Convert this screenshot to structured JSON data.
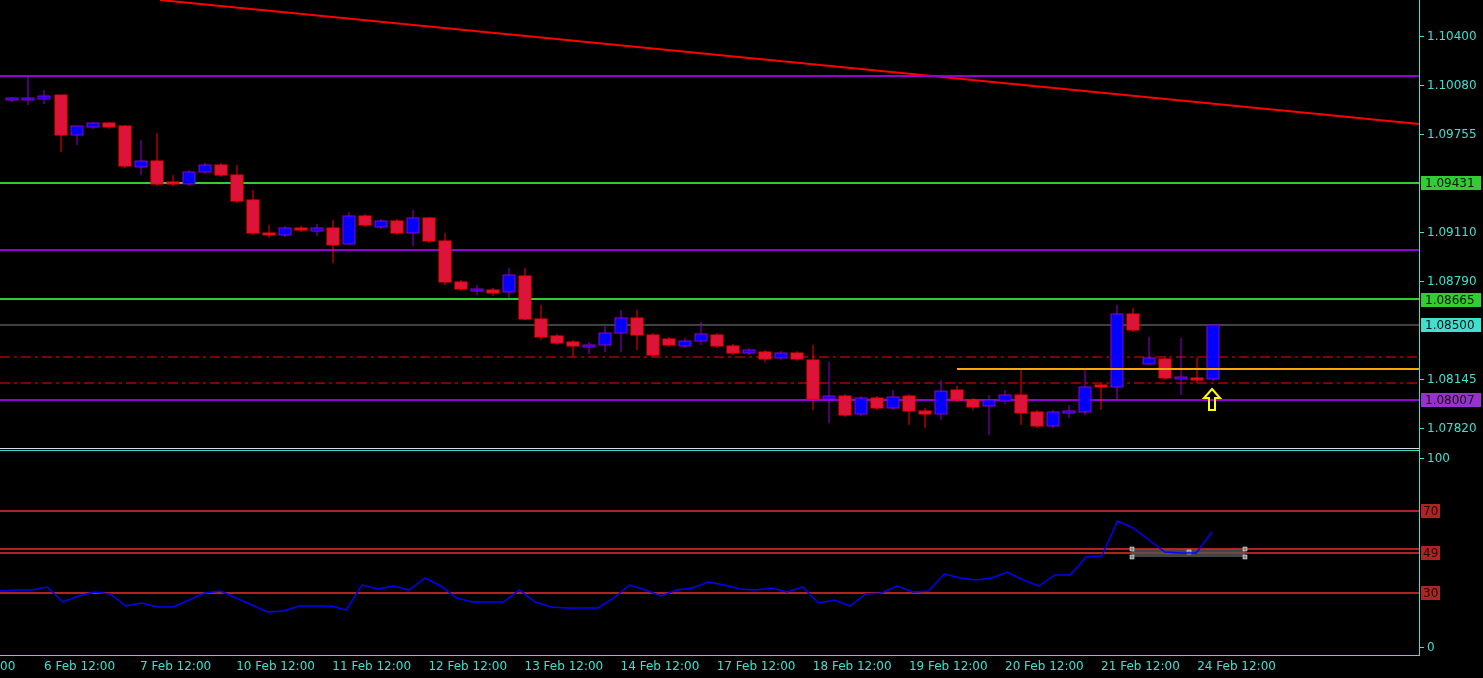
{
  "price_axis": {
    "labels": [
      "1.10400",
      "1.10080",
      "1.09755",
      "1.09110",
      "1.08790",
      "1.08145",
      "1.07820"
    ]
  },
  "price_levels": [
    {
      "label": "1.09431",
      "color": "#32cd32"
    },
    {
      "label": "1.08665",
      "color": "#32cd32"
    },
    {
      "label": "1.08500",
      "color": "#40e0d0"
    },
    {
      "label": "1.08007",
      "color": "#9932cc"
    }
  ],
  "rsi": {
    "axis_labels": [
      "100",
      "0"
    ],
    "levels": [
      {
        "label": "70"
      },
      {
        "label": "49"
      },
      {
        "label": "30"
      }
    ]
  },
  "time_axis": {
    "labels": [
      "00",
      "6 Feb 12:00",
      "7 Feb 12:00",
      "10 Feb 12:00",
      "11 Feb 12:00",
      "12 Feb 12:00",
      "13 Feb 12:00",
      "14 Feb 12:00",
      "17 Feb 12:00",
      "18 Feb 12:00",
      "19 Feb 12:00",
      "20 Feb 12:00",
      "21 Feb 12:00",
      "24 Feb 12:00"
    ]
  }
}
